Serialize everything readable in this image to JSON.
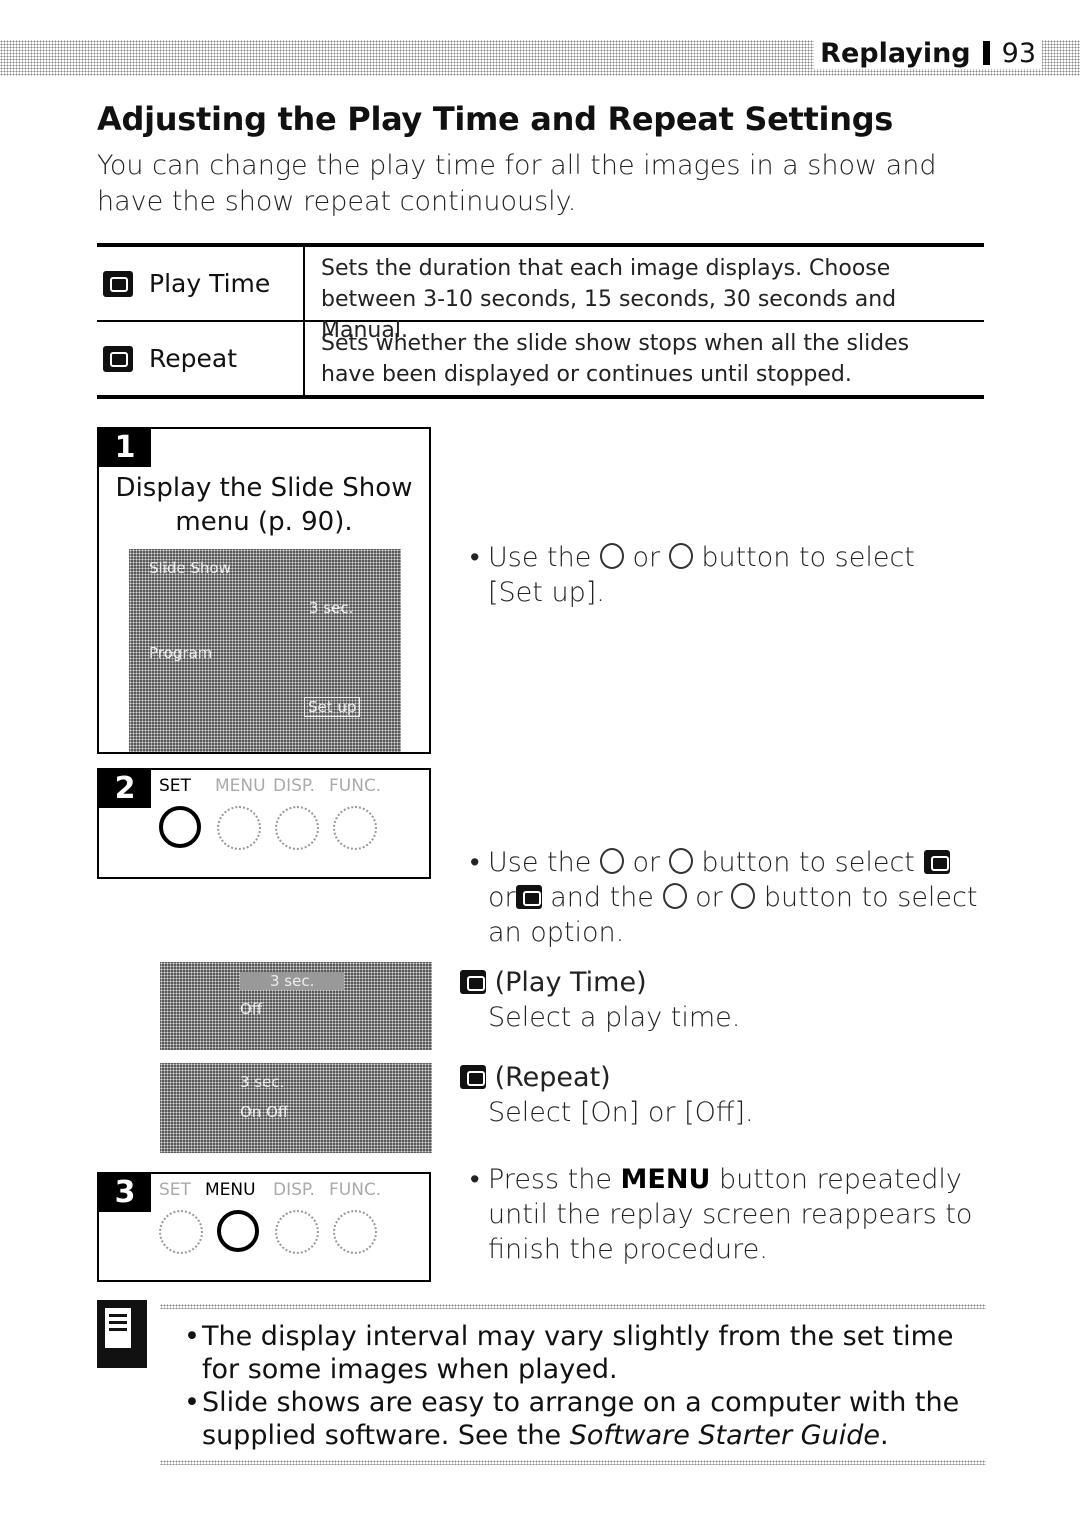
{
  "header": {
    "section": "Replaying",
    "page": "93"
  },
  "title": "Adjusting the Play Time and Repeat Settings",
  "intro": "You can change the play time for all the images in a show and have the show repeat continuously.",
  "table": [
    {
      "icon": "play-time-icon",
      "label": "Play Time",
      "description": "Sets the duration that each image displays. Choose between 3-10 seconds, 15 seconds, 30 seconds and Manual."
    },
    {
      "icon": "repeat-icon",
      "label": "Repeat",
      "description": "Sets whether the slide show stops when all the slides have been displayed or continues until stopped."
    }
  ],
  "steps": [
    {
      "number": "1",
      "text": "Display the Slide Show menu (p. 90).",
      "lcd": {
        "title": "Slide Show",
        "value": "3 sec.",
        "item": "Program",
        "button": "Set up"
      }
    },
    {
      "number": "2",
      "camera_buttons": [
        "SET",
        "MENU",
        "DISP.",
        "FUNC."
      ]
    },
    {
      "number": "3",
      "camera_buttons": [
        "SET",
        "MENU",
        "DISP.",
        "FUNC."
      ]
    }
  ],
  "lcd_screens": [
    {
      "row1": "3 sec.",
      "row2": "Off"
    },
    {
      "row1": "3 sec.",
      "row2": "On Off"
    }
  ],
  "instructions": {
    "bullet1": {
      "pre": "Use the",
      "mid": "or",
      "post": "button to select [Set up]."
    },
    "bullet2": {
      "p1": "Use the",
      "p2": "or",
      "p3": "button to select",
      "p4": "or",
      "p5": "and the",
      "p6": "or",
      "p7": "button to select an option."
    },
    "play_time": {
      "heading": "(Play Time)",
      "text": "Select a play time."
    },
    "repeat": {
      "heading": "(Repeat)",
      "text": "Select [On] or [Off]."
    },
    "bullet3": {
      "pre": "Press the",
      "key": "MENU",
      "post": "button repeatedly until the replay screen reappears to finish the procedure."
    }
  },
  "notes": {
    "items": [
      "The display interval may vary slightly from the set time for some images when played.",
      {
        "pre": "Slide shows are easy to arrange on a computer with the supplied software. See the ",
        "italic": "Software Starter Guide",
        "post": "."
      }
    ]
  }
}
